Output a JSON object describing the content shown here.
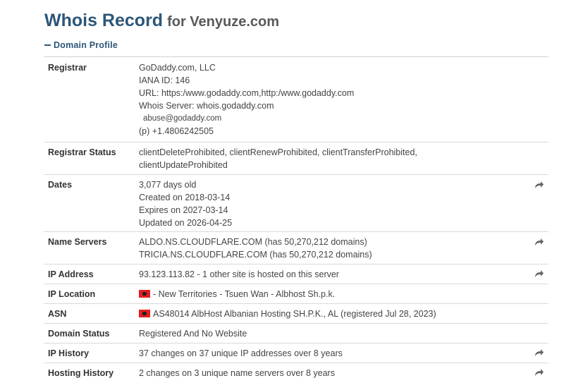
{
  "header": {
    "title": "Whois Record",
    "for_text": "for Venyuze.com"
  },
  "section": {
    "label": "Domain Profile"
  },
  "rows": {
    "registrar": {
      "label": "Registrar",
      "lines": [
        "GoDaddy.com, LLC",
        "IANA ID: 146",
        "URL: https:/www.godaddy.com,http:/www.godaddy.com",
        "Whois Server: whois.godaddy.com",
        "abuse@godaddy.com",
        "(p) +1.4806242505"
      ]
    },
    "registrar_status": {
      "label": "Registrar Status",
      "lines": [
        "clientDeleteProhibited, clientRenewProhibited, clientTransferProhibited,",
        "clientUpdateProhibited"
      ]
    },
    "dates": {
      "label": "Dates",
      "lines": [
        "3,077 days old",
        "Created on 2018-03-14",
        "Expires on 2027-03-14",
        "Updated on 2026-04-25"
      ]
    },
    "name_servers": {
      "label": "Name Servers",
      "lines": [
        "ALDO.NS.CLOUDFLARE.COM (has 50,270,212 domains)",
        "TRICIA.NS.CLOUDFLARE.COM (has 50,270,212 domains)"
      ]
    },
    "ip_address": {
      "label": "IP Address",
      "value": "93.123.113.82 - 1 other site is hosted on this server"
    },
    "ip_location": {
      "label": "IP Location",
      "value": "- New Territories - Tsuen Wan - Albhost Sh.p.k."
    },
    "asn": {
      "label": "ASN",
      "value": "AS48014 AlbHost Albanian Hosting SH.P.K., AL (registered Jul 28, 2023)"
    },
    "domain_status": {
      "label": "Domain Status",
      "value": "Registered And No Website"
    },
    "ip_history": {
      "label": "IP History",
      "value": "37 changes on 37 unique IP addresses over 8 years"
    },
    "hosting_history": {
      "label": "Hosting History",
      "value": "2 changes on 3 unique name servers over 8 years"
    }
  },
  "icons": {
    "share": "share-arrow-icon",
    "flag": "albania-flag-icon"
  },
  "colors": {
    "title": "#2c5678",
    "link": "#2c5678",
    "border": "#d9d9d9"
  }
}
